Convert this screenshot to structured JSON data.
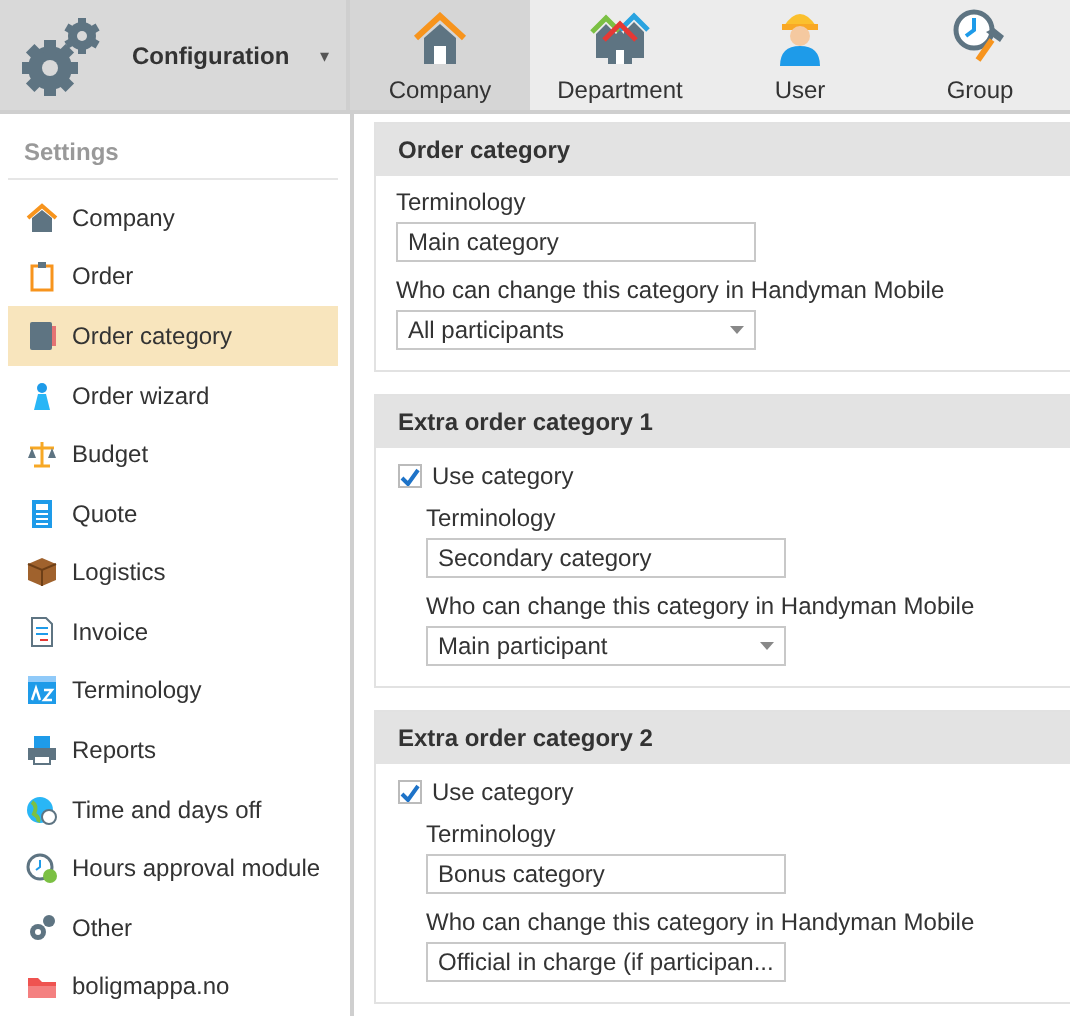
{
  "header": {
    "title": "Configuration",
    "caret": "▾"
  },
  "tabs": [
    {
      "label": "Company",
      "selected": true
    },
    {
      "label": "Department",
      "selected": false
    },
    {
      "label": "User",
      "selected": false
    },
    {
      "label": "Group",
      "selected": false
    }
  ],
  "sidebar": {
    "heading": "Settings",
    "items": [
      {
        "label": "Company",
        "selected": false
      },
      {
        "label": "Order",
        "selected": false
      },
      {
        "label": "Order category",
        "selected": true
      },
      {
        "label": "Order wizard",
        "selected": false
      },
      {
        "label": "Budget",
        "selected": false
      },
      {
        "label": "Quote",
        "selected": false
      },
      {
        "label": "Logistics",
        "selected": false
      },
      {
        "label": "Invoice",
        "selected": false
      },
      {
        "label": "Terminology",
        "selected": false
      },
      {
        "label": "Reports",
        "selected": false
      },
      {
        "label": "Time and days off",
        "selected": false
      },
      {
        "label": "Hours approval module",
        "selected": false
      },
      {
        "label": "Other",
        "selected": false
      },
      {
        "label": "boligmappa.no",
        "selected": false
      }
    ]
  },
  "sections": [
    {
      "kind": "main",
      "title": "Order category",
      "terminology_label": "Terminology",
      "terminology_value": "Main category",
      "who_label": "Who can change this category in Handyman Mobile",
      "who_value": "All participants"
    },
    {
      "kind": "extra",
      "title": "Extra order category 1",
      "use_label": "Use category",
      "use_checked": true,
      "terminology_label": "Terminology",
      "terminology_value": "Secondary category",
      "who_label": "Who can change this category in Handyman Mobile",
      "who_value": "Main participant"
    },
    {
      "kind": "extra",
      "title": "Extra order category 2",
      "use_label": "Use category",
      "use_checked": true,
      "terminology_label": "Terminology",
      "terminology_value": "Bonus category",
      "who_label": "Who can change this category in Handyman Mobile",
      "who_value": "Official in charge (if participan..."
    }
  ]
}
